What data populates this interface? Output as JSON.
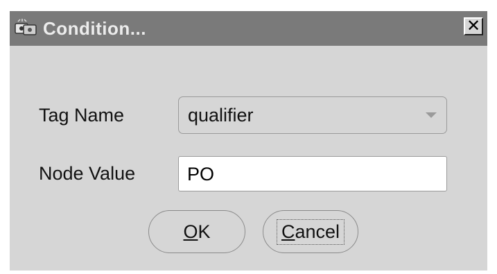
{
  "dialog": {
    "title": "Condition...",
    "close_symbol": "✕",
    "icon": "app-window-icon"
  },
  "fields": {
    "tag_name": {
      "label": "Tag Name",
      "value": "qualifier"
    },
    "node_value": {
      "label": "Node Value",
      "value": "PO"
    }
  },
  "buttons": {
    "ok": {
      "mnemonic": "O",
      "rest": "K"
    },
    "cancel": {
      "mnemonic": "C",
      "rest": "ancel"
    }
  }
}
